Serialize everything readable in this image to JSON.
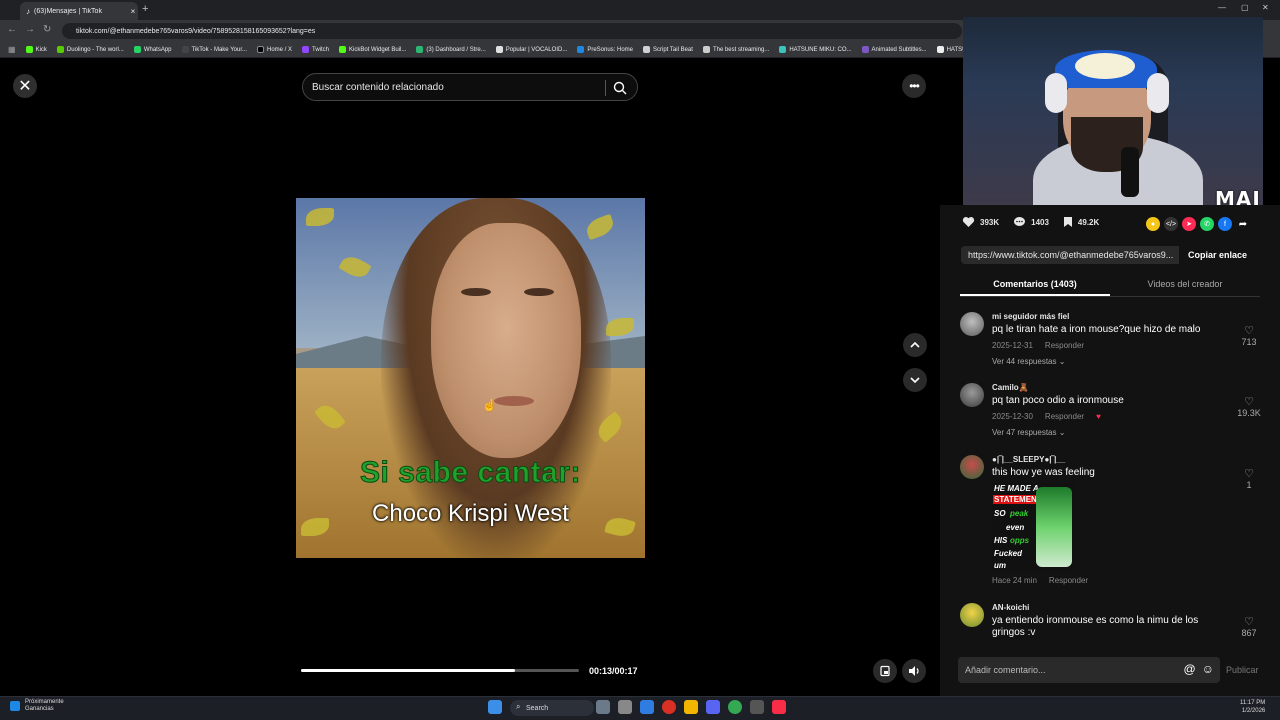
{
  "browser": {
    "tab_title": "(63)Mensajes | TikTok",
    "url": "tiktok.com/@ethanmedebe765varos9/video/7589528158165093652?lang=es",
    "bookmarks": [
      {
        "label": "Kick",
        "color": "#53fc18"
      },
      {
        "label": "Duolingo - The worl...",
        "color": "#58cc02"
      },
      {
        "label": "WhatsApp",
        "color": "#25d366"
      },
      {
        "label": "TikTok - Make Your...",
        "color": "#111111"
      },
      {
        "label": "Home / X",
        "color": "#000000"
      },
      {
        "label": "Twitch",
        "color": "#9146ff"
      },
      {
        "label": "KickBot Widget Buil...",
        "color": "#53fc18"
      },
      {
        "label": "(3) Dashboard / Stre...",
        "color": "#2bb673"
      },
      {
        "label": "Popular | VOCALOID...",
        "color": "#e0e0e0"
      },
      {
        "label": "PreSonus: Home",
        "color": "#1e88e5"
      },
      {
        "label": "Script Tail Beat",
        "color": "#d0d0d0"
      },
      {
        "label": "The best streaming...",
        "color": "#cccccc"
      },
      {
        "label": "HATSUNE MIKU: CO...",
        "color": "#39c5bb"
      },
      {
        "label": "Animated Subtitles...",
        "color": "#7e57c2"
      },
      {
        "label": "HATSUNE MIKU",
        "color": "#eeeeee"
      }
    ]
  },
  "search": {
    "placeholder": "Buscar contenido relacionado"
  },
  "video": {
    "caption_green": "Si sabe cantar:",
    "caption_white": "Choco Krispi West",
    "time": "00:13/00:17",
    "progress": 0.77
  },
  "webcam": {
    "logo": "MAI"
  },
  "stats": {
    "likes": "393K",
    "comments": "1403",
    "saves": "49.2K"
  },
  "share": {
    "link": "https://www.tiktok.com/@ethanmedebe765varos9...",
    "copy_label": "Copiar enlace"
  },
  "tabs": {
    "comments": "Comentarios (1403)",
    "creator_videos": "Videos del creador"
  },
  "comments": [
    {
      "user": "mi seguidor más fiel",
      "text": "pq le tiran hate a iron mouse?que hizo de malo",
      "date": "2025-12-31",
      "reply": "Responder",
      "replies": "Ver 44 respuestas",
      "likes": "713"
    },
    {
      "user": "Camilo🧸",
      "text": "pq tan poco odio a ironmouse",
      "date": "2025-12-30",
      "reply": "Responder",
      "replies": "Ver 47 respuestas",
      "likes": "19.3K"
    },
    {
      "user": "●|‾|__SLEEPY●|‾|__",
      "text": "this how ye was feeling",
      "date": "Hace 24 min",
      "reply": "Responder",
      "likes": "1",
      "sticker": [
        "HE MADE A",
        "STATEMENT",
        "SO",
        "peak",
        "even",
        "HIS",
        "opps",
        "Fucked",
        "um"
      ]
    },
    {
      "user": "AN-koichi",
      "text": "ya entiendo ironmouse es como la nimu de los gringos :v",
      "likes": "867"
    }
  ],
  "comment_input": {
    "placeholder": "Añadir comentario...",
    "publish": "Publicar"
  },
  "taskbar": {
    "weather_line1": "Próximamente",
    "weather_line2": "Ganancias",
    "search": "Search",
    "time": "11:17 PM",
    "date": "1/2/2026"
  }
}
